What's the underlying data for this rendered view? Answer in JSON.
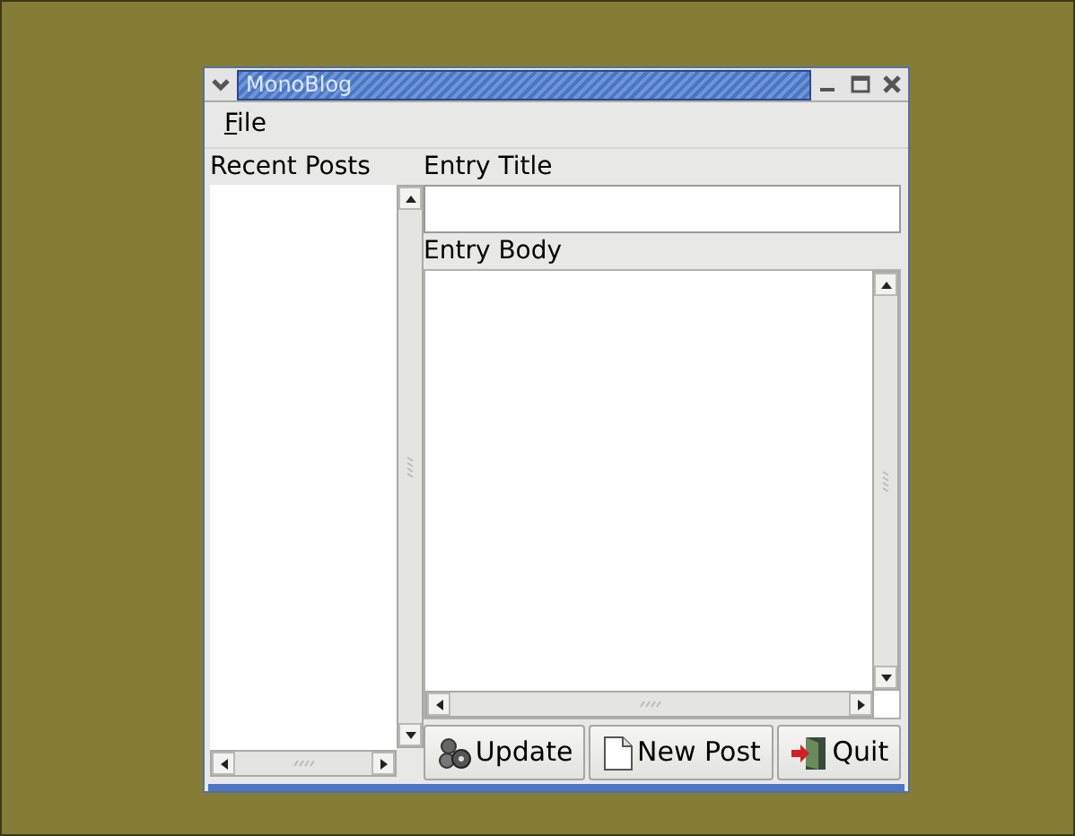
{
  "window": {
    "title": "MonoBlog"
  },
  "menu": [
    {
      "label": "File"
    }
  ],
  "recent_posts": {
    "label": "Recent Posts"
  },
  "entry_title": {
    "label": "Entry Title"
  },
  "entry_body": {
    "label": "Entry Body"
  },
  "buttons": [
    {
      "label": "Update",
      "kind": "update"
    },
    {
      "label": "New Post",
      "kind": "new"
    },
    {
      "label": "Quit",
      "kind": "quit"
    }
  ]
}
